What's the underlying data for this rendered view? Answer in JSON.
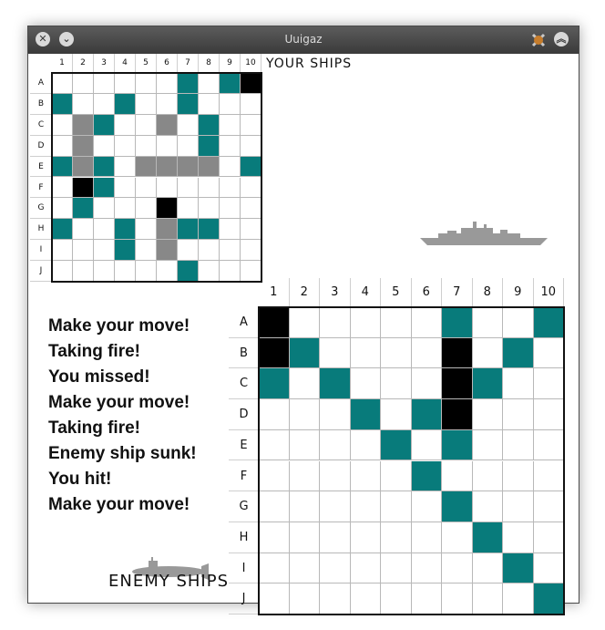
{
  "window": {
    "title": "Uuigaz"
  },
  "colors": {
    "water": "#ffffff",
    "ship": "#087b7b",
    "hit": "#000000",
    "sunk": "#888888"
  },
  "headings": {
    "your_ships": "YOUR SHIPS",
    "enemy_ships": "ENEMY SHIPS"
  },
  "columns": [
    "1",
    "2",
    "3",
    "4",
    "5",
    "6",
    "7",
    "8",
    "9",
    "10"
  ],
  "rows": [
    "A",
    "B",
    "C",
    "D",
    "E",
    "F",
    "G",
    "H",
    "I",
    "J"
  ],
  "your_grid": [
    "......T.TX",
    "T..T..T...",
    ".ST..S.T..",
    ".S.....T..",
    "TST.SSSS.T",
    ".XT.......",
    ".T...X....",
    "T..T.STT..",
    "...T.S....",
    "......T..."
  ],
  "enemy_grid": [
    "X.....T..T",
    "XT....X.T.",
    "T.T...XT..",
    "...T.TX...",
    "....T.T...",
    ".....T....",
    "......T...",
    ".......T..",
    "........T.",
    ".........T"
  ],
  "status": {
    "messages": [
      "Make your move!",
      "Taking fire!",
      "You missed!",
      "Make your move!",
      "Taking fire!",
      "Enemy ship sunk!",
      "You hit!",
      "Make your move!"
    ]
  },
  "icons": {
    "close": "close-icon",
    "minimize": "chevron-down-icon",
    "app": "app-icon",
    "maximize": "chevrons-up-icon"
  }
}
